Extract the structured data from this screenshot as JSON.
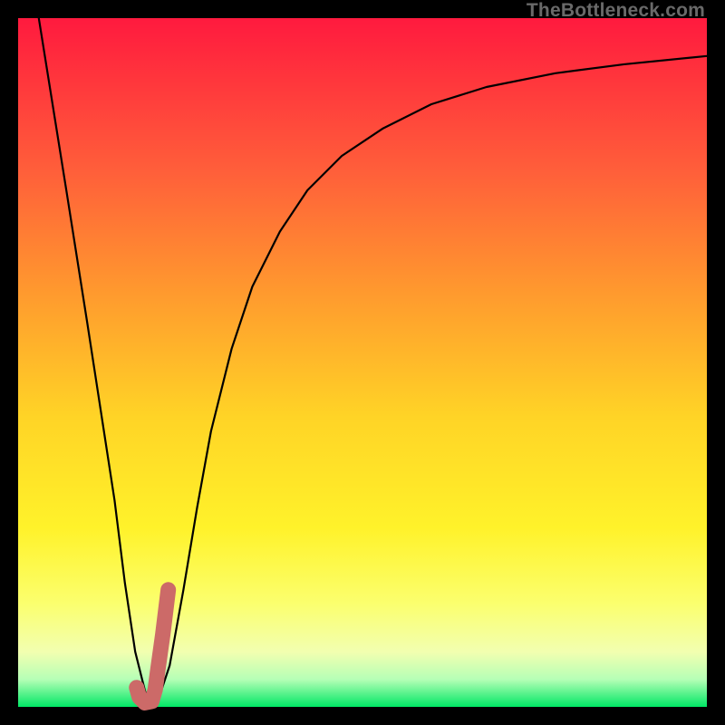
{
  "watermark": "TheBottleneck.com",
  "colors": {
    "frame": "#000000",
    "curve_main": "#000000",
    "curve_accent": "#cc6a68",
    "gradient_css": "linear-gradient(to bottom, #ff1a3e 0%, #ff5e3a 22%, #ff9a2e 40%, #ffd426 58%, #fff22a 74%, #fbff6e 85%, #f2ffb0 92%, #b6ffb6 96%, #00e765 100%)"
  },
  "chart_data": {
    "type": "line",
    "title": "",
    "xlabel": "",
    "ylabel": "",
    "xlim": [
      0,
      100
    ],
    "ylim": [
      0,
      100
    ],
    "grid": false,
    "series": [
      {
        "name": "bottleneck-curve",
        "x": [
          3,
          7,
          10,
          12,
          14,
          15.5,
          17,
          18.5,
          20,
          22,
          24,
          26,
          28,
          31,
          34,
          38,
          42,
          47,
          53,
          60,
          68,
          78,
          88,
          100
        ],
        "y": [
          100,
          75,
          56,
          43,
          30,
          18,
          8,
          2,
          0,
          6,
          17,
          29,
          40,
          52,
          61,
          69,
          75,
          80,
          84,
          87.5,
          90,
          92,
          93.3,
          94.5
        ]
      },
      {
        "name": "accent-segment",
        "x": [
          17.2,
          17.6,
          18.4,
          19.4,
          19.9,
          20.3,
          21.0,
          21.8
        ],
        "y": [
          2.8,
          1.4,
          0.6,
          0.8,
          2.5,
          5.5,
          10.5,
          17
        ]
      }
    ]
  }
}
